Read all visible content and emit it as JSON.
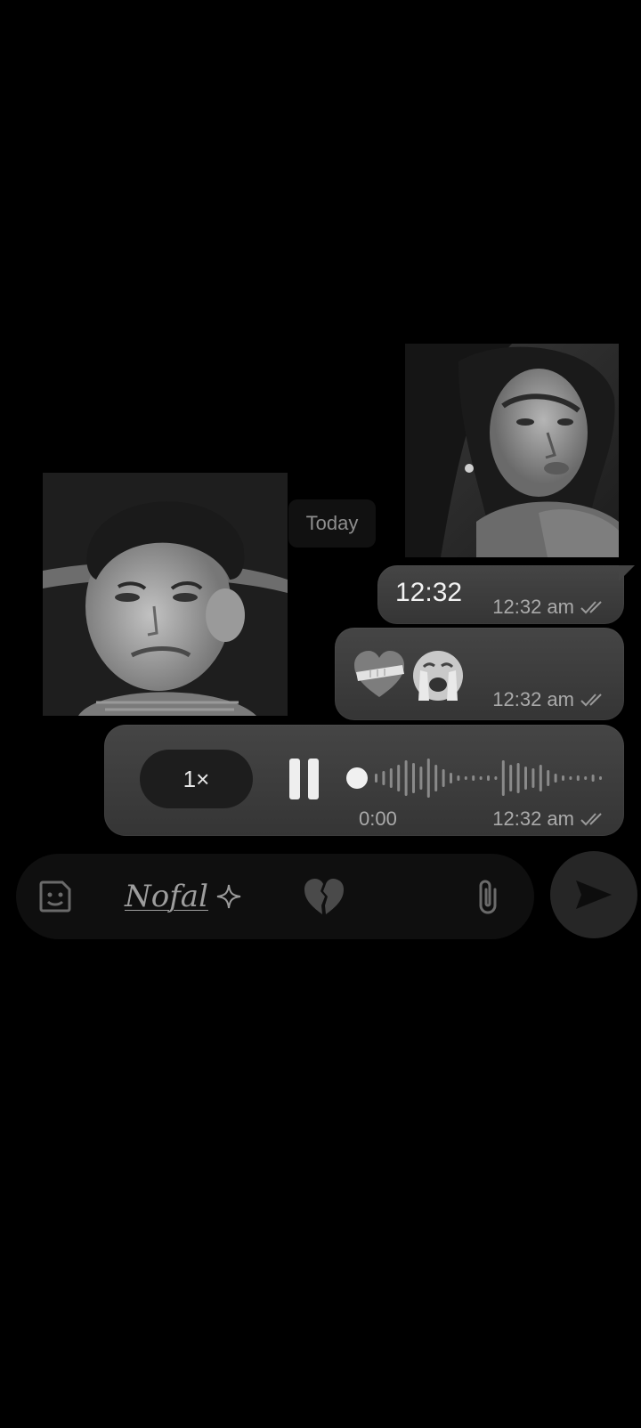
{
  "chat": {
    "date_label": "Today",
    "messages": [
      {
        "type": "image",
        "subject": "woman-photo"
      },
      {
        "type": "text",
        "text": "12:32",
        "time": "12:32 am",
        "status": "read-double-check"
      },
      {
        "type": "emoji",
        "emojis": [
          "heart-with-bandage-emoji",
          "crying-face-emoji"
        ],
        "time": "12:32 am",
        "status": "read-double-check"
      },
      {
        "type": "voice",
        "speed": "1×",
        "state": "playing",
        "elapsed": "0:00",
        "time": "12:32 am",
        "status": "read-double-check"
      },
      {
        "type": "image",
        "subject": "boy-photo"
      }
    ]
  },
  "composer": {
    "text": "Nofal",
    "icons": [
      "sticker-icon",
      "sparkle-icon",
      "broken-heart-icon",
      "paperclip-icon",
      "send-icon"
    ]
  },
  "theme": {
    "background": "#000000",
    "bubble": "#404040",
    "meta_text": "#aaaaaa",
    "chip": "#111111"
  }
}
